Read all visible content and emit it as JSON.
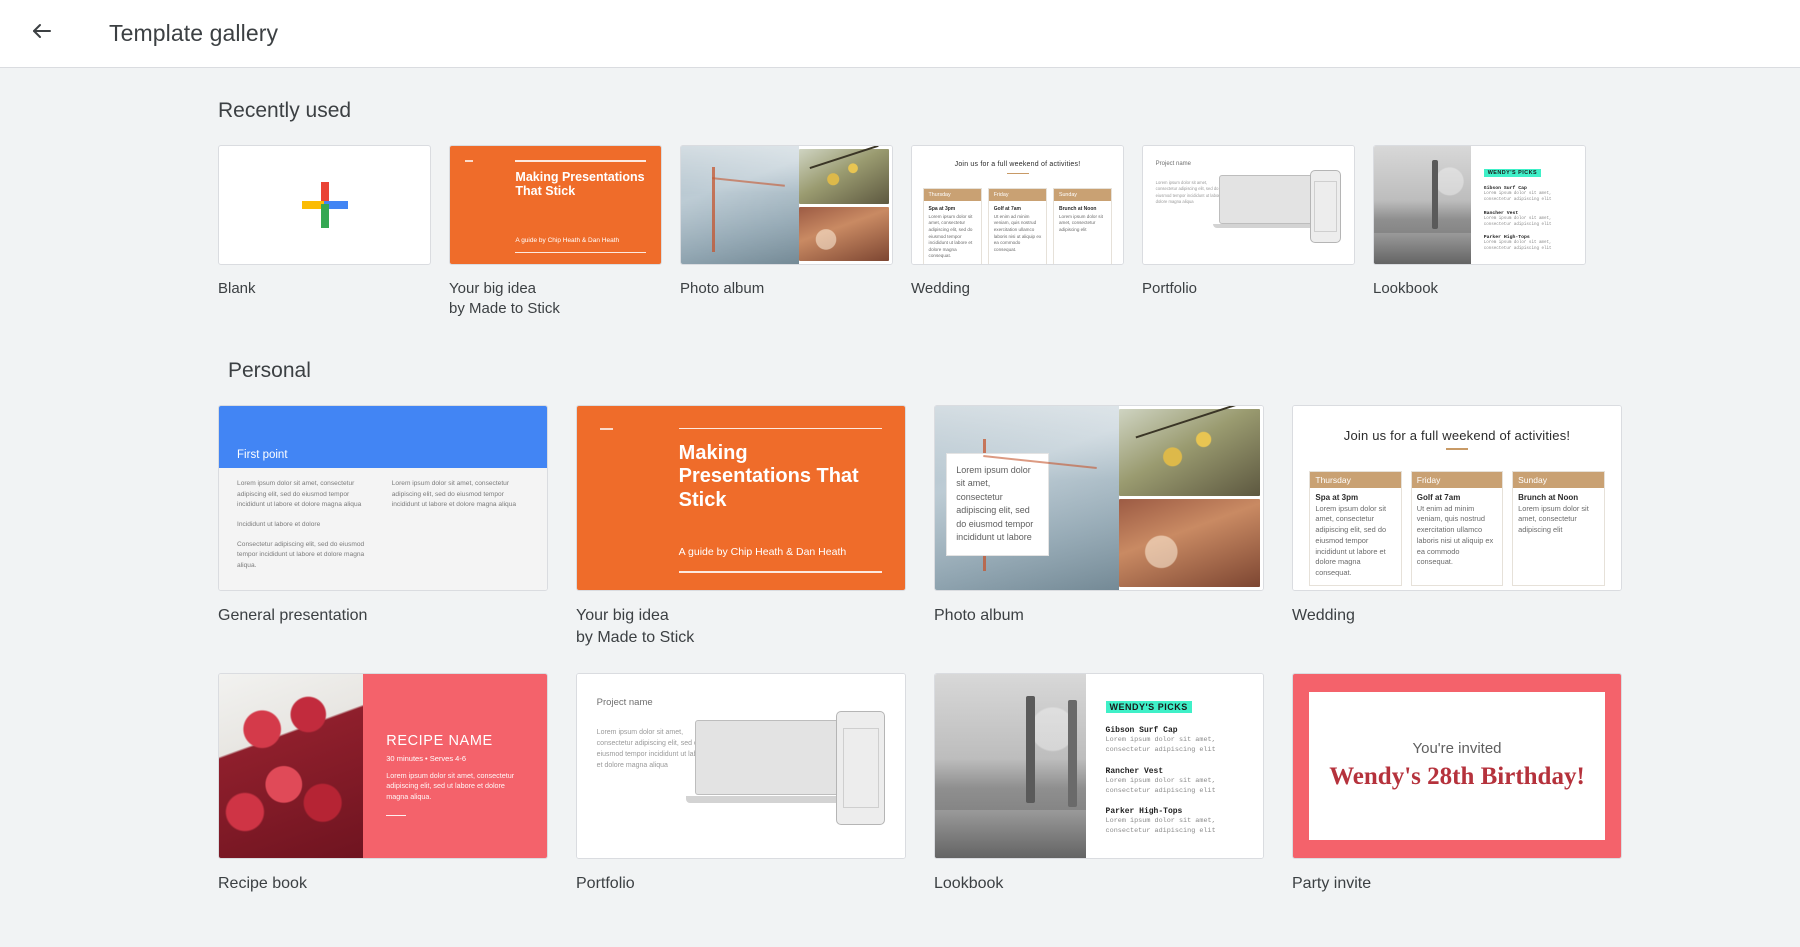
{
  "header": {
    "title": "Template gallery",
    "back_icon": "arrow-left-icon"
  },
  "sections": {
    "recent": {
      "title": "Recently used",
      "items": [
        {
          "name": "Blank",
          "sub": "",
          "art": "blank"
        },
        {
          "name": "Your big idea",
          "sub": "by Made to Stick",
          "art": "bigidea"
        },
        {
          "name": "Photo album",
          "sub": "",
          "art": "album"
        },
        {
          "name": "Wedding",
          "sub": "",
          "art": "wedding"
        },
        {
          "name": "Portfolio",
          "sub": "",
          "art": "portfolio"
        },
        {
          "name": "Lookbook",
          "sub": "",
          "art": "lookbook"
        }
      ]
    },
    "personal": {
      "title": "Personal",
      "items": [
        {
          "name": "General presentation",
          "sub": "",
          "art": "general"
        },
        {
          "name": "Your big idea",
          "sub": "by Made to Stick",
          "art": "bigidea"
        },
        {
          "name": "Photo album",
          "sub": "",
          "art": "album"
        },
        {
          "name": "Wedding",
          "sub": "",
          "art": "wedding"
        },
        {
          "name": "Recipe book",
          "sub": "",
          "art": "recipe"
        },
        {
          "name": "Portfolio",
          "sub": "",
          "art": "portfolio"
        },
        {
          "name": "Lookbook",
          "sub": "",
          "art": "lookbook"
        },
        {
          "name": "Party invite",
          "sub": "",
          "art": "party"
        }
      ]
    }
  },
  "art_content": {
    "bigidea": {
      "title": "Making Presentations That Stick",
      "byline": "A guide by Chip Heath & Dan Heath"
    },
    "album": {
      "overlay_text": "Lorem ipsum dolor sit amet, consectetur adipiscing elit, sed do eiusmod tempor incididunt ut labore"
    },
    "wedding": {
      "heading": "Join us for a full weekend of activities!",
      "columns": [
        {
          "day": "Thursday",
          "event": "Spa at 3pm",
          "body": "Lorem ipsum dolor sit amet, consectetur adipiscing elit, sed do eiusmod tempor incididunt ut labore et dolore magna consequat."
        },
        {
          "day": "Friday",
          "event": "Golf at 7am",
          "body": "Ut enim ad minim veniam, quis nostrud exercitation ullamco laboris nisi ut aliquip ex ea commodo consequat."
        },
        {
          "day": "Sunday",
          "event": "Brunch at Noon",
          "body": "Lorem ipsum dolor sit amet, consectetur adipiscing elit"
        }
      ]
    },
    "portfolio": {
      "project_name": "Project name",
      "body": "Lorem ipsum dolor sit amet, consectetur adipiscing elit, sed do eiusmod tempor incididunt ut labore et dolore magna aliqua"
    },
    "lookbook": {
      "headline": "WENDY'S PICKS",
      "items": [
        {
          "name": "Gibson Surf Cap",
          "body": "Lorem ipsum dolor sit amet, consectetur adipiscing elit"
        },
        {
          "name": "Rancher Vest",
          "body": "Lorem ipsum dolor sit amet, consectetur adipiscing elit"
        },
        {
          "name": "Parker High-Tops",
          "body": "Lorem ipsum dolor sit amet, consectetur adipiscing elit"
        }
      ]
    },
    "recipe": {
      "title": "RECIPE NAME",
      "meta": "30 minutes • Serves 4-6",
      "body": "Lorem ipsum dolor sit amet, consectetur adipiscing elit, sed ut labore et dolore magna aliqua."
    },
    "party": {
      "top": "You're invited",
      "headline": "Wendy's 28th Birthday!"
    },
    "general": {
      "heading": "First point",
      "col1_p1": "Lorem ipsum dolor sit amet, consectetur adipiscing elit, sed do eiusmod tempor incididunt ut labore et dolore magna aliqua",
      "col1_p2": "Incididunt ut labore et dolore",
      "col1_p3": "Consectetur adipiscing elit, sed do eiusmod tempor incididunt ut labore et dolore magna aliqua.",
      "col2_p1": "Lorem ipsum dolor sit amet, consectetur adipiscing elit, sed do eiusmod tempor incididunt ut labore et dolore magna aliqua"
    }
  },
  "colors": {
    "page_bg": "#f1f3f4",
    "header_bg": "#ffffff",
    "text": "#3c4043",
    "orange": "#ef6c2a",
    "blue": "#4285f4",
    "red": "#f4626b",
    "tan": "#c9a173",
    "mint": "#3ff0c8"
  }
}
